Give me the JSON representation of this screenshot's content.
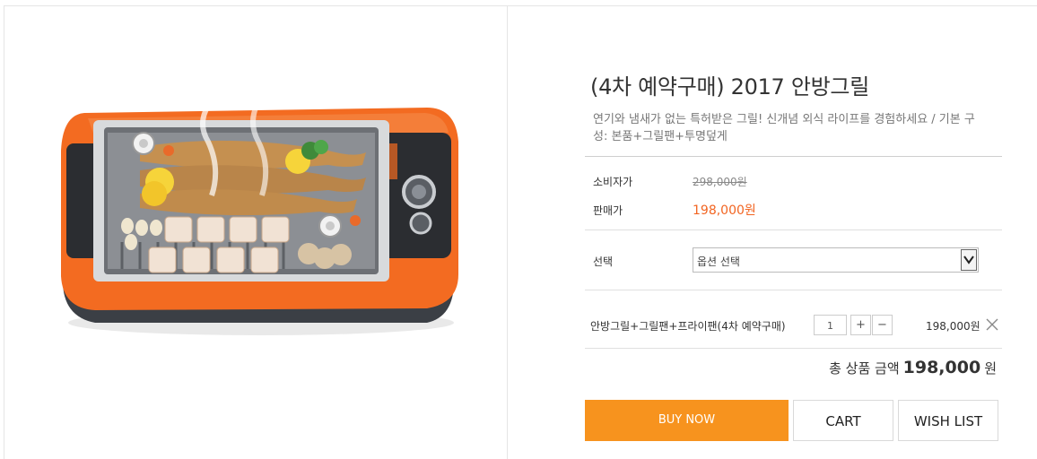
{
  "product": {
    "title": "(4차 예약구매) 2017 안방그릴",
    "description": "연기와 냄새가 없는 특허받은 그릴! 신개념 외식 라이프를 경험하세요 / 기본 구성: 본품+그릴팬+투명덮게",
    "image_alt": "grill-product-photo"
  },
  "prices": {
    "consumer_label": "소비자가",
    "consumer_price": "298,000원",
    "sale_label": "판매가",
    "sale_price": "198,000원"
  },
  "option": {
    "label": "선택",
    "selected": "옵션 선택"
  },
  "selected_item": {
    "name": "안방그릴+그릴팬+프라이팬(4차 예약구매)",
    "quantity": "1",
    "plus": "+",
    "minus": "−",
    "price": "198,000원"
  },
  "total": {
    "label": "총 상품 금액",
    "amount": "198,000",
    "unit": "원"
  },
  "buttons": {
    "buy": "BUY NOW",
    "cart": "CART",
    "wish": "WISH LIST"
  },
  "colors": {
    "accent": "#f7931e",
    "sale": "#f26522"
  }
}
